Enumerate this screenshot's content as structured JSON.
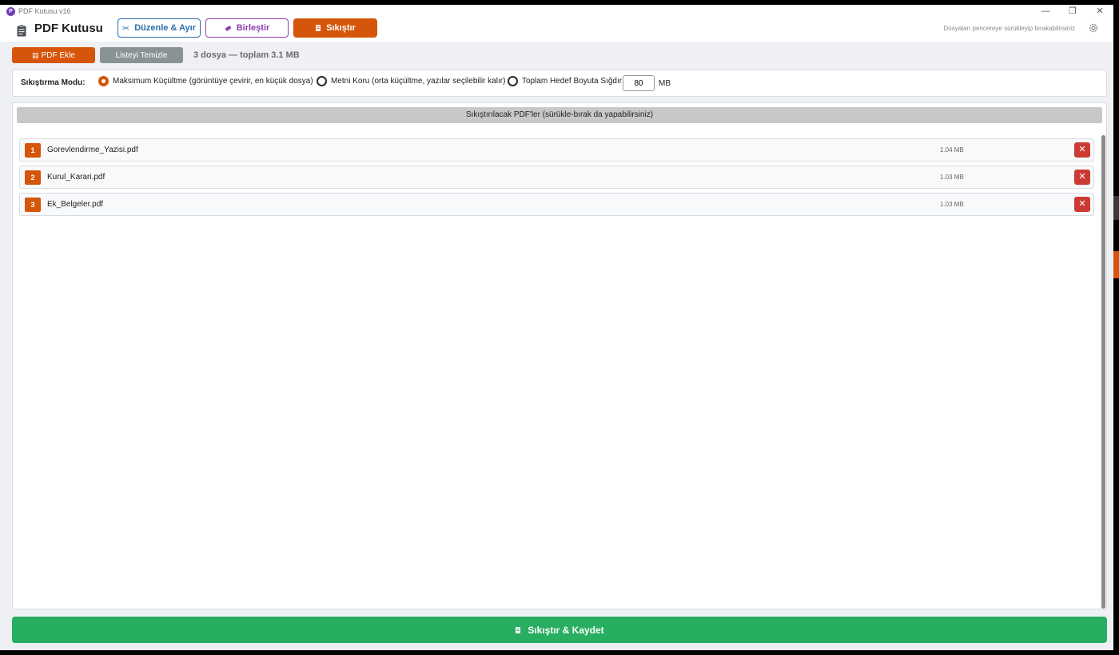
{
  "window": {
    "title": "PDF Kutusu v16",
    "logo_letter": "P",
    "controls": {
      "minimize": "—",
      "maximize": "❐",
      "close": "✕"
    }
  },
  "header": {
    "brand_title": "PDF Kutusu",
    "tabs": [
      {
        "label": "Düzenle & Ayır",
        "icon": "scissors-icon",
        "color": "#2a6fab"
      },
      {
        "label": "Birleştir",
        "icon": "eraser-icon",
        "color": "#8e3fb0"
      },
      {
        "label": "Sıkıştır",
        "icon": "scroll-icon",
        "color": "#d5550a",
        "active": true
      }
    ],
    "drop_hint": "Dosyaları pencereye sürükleyip bırakabilirsiniz"
  },
  "toolbar": {
    "add_label": "PDF Ekle",
    "clear_label": "Listeyi Temizle",
    "summary": "3 dosya — toplam 3.1 MB"
  },
  "mode": {
    "label": "Sıkıştırma Modu:",
    "options": [
      {
        "label": "Maksimum Küçültme (görüntüye çevirir, en küçük dosya)",
        "selected": true
      },
      {
        "label": "Metni Koru (orta küçültme, yazılar seçilebilir kalır)",
        "selected": false
      },
      {
        "label": "Toplam Hedef Boyuta Sığdır:",
        "selected": false
      }
    ],
    "target_value": "80",
    "target_unit": "MB"
  },
  "list": {
    "header": "Sıkıştırılacak PDF'ler (sürükle-bırak da yapabilirsiniz)",
    "files": [
      {
        "num": "1",
        "name": "Gorevlendirme_Yazisi.pdf",
        "size": "1.04 MB"
      },
      {
        "num": "2",
        "name": "Kurul_Karari.pdf",
        "size": "1.03 MB"
      },
      {
        "num": "3",
        "name": "Ek_Belgeler.pdf",
        "size": "1.03 MB"
      }
    ],
    "delete_glyph": "✕"
  },
  "footer": {
    "save_label": "Sıkıştır & Kaydet"
  },
  "colors": {
    "accent": "#d5550a",
    "save": "#28ae60",
    "delete": "#cc3b33",
    "neutral": "#8a9394"
  }
}
